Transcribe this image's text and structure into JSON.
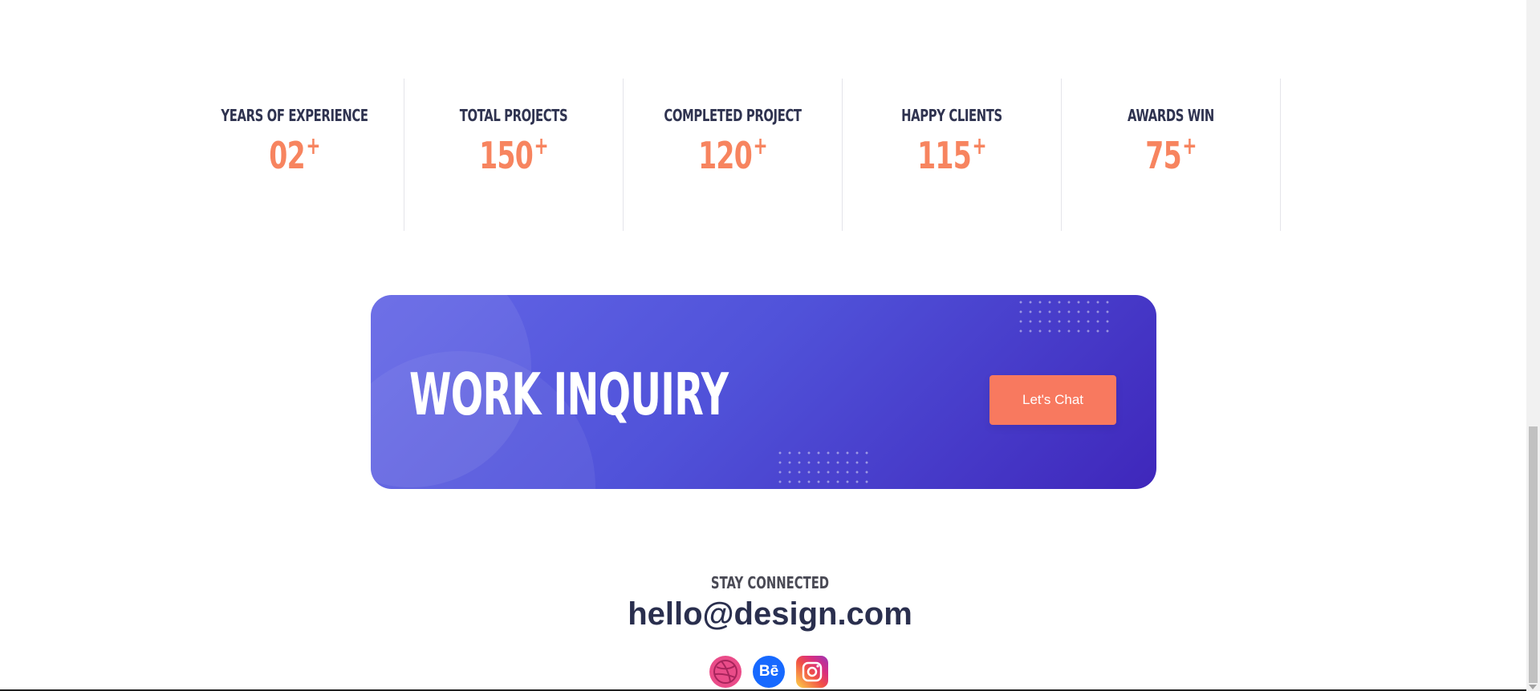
{
  "stats": [
    {
      "label": "Years of Experience",
      "value": "02",
      "suffix": "+"
    },
    {
      "label": "Total Projects",
      "value": "150",
      "suffix": "+"
    },
    {
      "label": "Completed Project",
      "value": "120",
      "suffix": "+"
    },
    {
      "label": "Happy Clients",
      "value": "115",
      "suffix": "+"
    },
    {
      "label": "Awards Win",
      "value": "75",
      "suffix": "+"
    }
  ],
  "cta": {
    "title": "WORK INQUIRY",
    "button_label": "Let's Chat"
  },
  "connect": {
    "label": "Stay Connected",
    "email": "hello@design.com"
  },
  "social": [
    {
      "name": "dribbble-icon",
      "glyph": ""
    },
    {
      "name": "behance-icon",
      "glyph": "Bē"
    },
    {
      "name": "instagram-icon",
      "glyph": ""
    }
  ],
  "colors": {
    "accent": "#f7845f",
    "cta_start": "#6366e6",
    "cta_end": "#3f27bb",
    "heading": "#2f3350"
  }
}
